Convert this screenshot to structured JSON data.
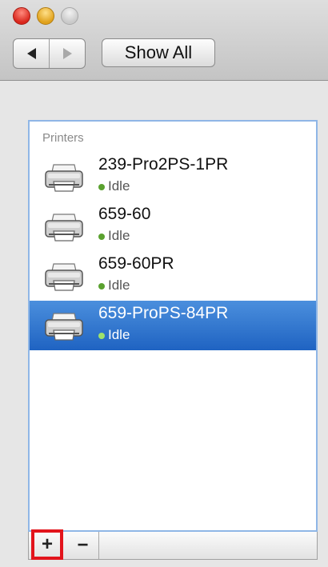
{
  "toolbar": {
    "show_all_label": "Show All"
  },
  "panel": {
    "heading": "Printers",
    "printers": [
      {
        "name": "239-Pro2PS-1PR",
        "status": "Idle",
        "selected": false
      },
      {
        "name": "659-60",
        "status": "Idle",
        "selected": false
      },
      {
        "name": "659-60PR",
        "status": "Idle",
        "selected": false
      },
      {
        "name": "659-ProPS-84PR",
        "status": "Idle",
        "selected": true
      }
    ]
  },
  "bottom_bar": {
    "add_label": "+",
    "remove_label": "−"
  },
  "colors": {
    "selection": "#1f63c2",
    "status_dot": "#5aa12f",
    "highlight_box": "#e2141c"
  },
  "icons": {
    "printer": "printer-icon",
    "back": "back-arrow-icon",
    "forward": "forward-arrow-icon"
  }
}
